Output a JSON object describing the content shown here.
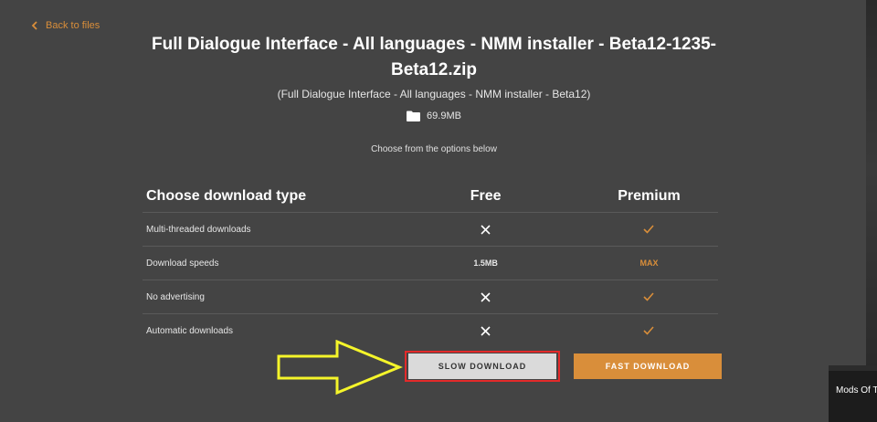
{
  "nav": {
    "back_label": "Back to files"
  },
  "file": {
    "title": "Full Dialogue Interface - All languages - NMM installer - Beta12-1235-Beta12.zip",
    "subtitle": "(Full Dialogue Interface - All languages - NMM installer - Beta12)",
    "size": "69.9MB",
    "size_icon": "folder-icon"
  },
  "instructions": "Choose from the options below",
  "table": {
    "headers": {
      "type": "Choose download type",
      "free": "Free",
      "premium": "Premium"
    },
    "rows": [
      {
        "label": "Multi-threaded downloads",
        "free": "cross-icon",
        "premium": "check-icon"
      },
      {
        "label": "Download speeds",
        "free": "1.5MB",
        "premium": "MAX"
      },
      {
        "label": "No advertising",
        "free": "cross-icon",
        "premium": "check-icon"
      },
      {
        "label": "Automatic downloads",
        "free": "cross-icon",
        "premium": "check-icon"
      }
    ]
  },
  "buttons": {
    "slow": "SLOW DOWNLOAD",
    "fast": "FAST DOWNLOAD"
  },
  "popup": {
    "text": "Mods Of T"
  },
  "colors": {
    "background": "#444444",
    "accent": "#d98e3a",
    "slow_button": "#dadada",
    "highlight_border": "#e32a2a",
    "annotation_arrow": "#f5f52a"
  }
}
